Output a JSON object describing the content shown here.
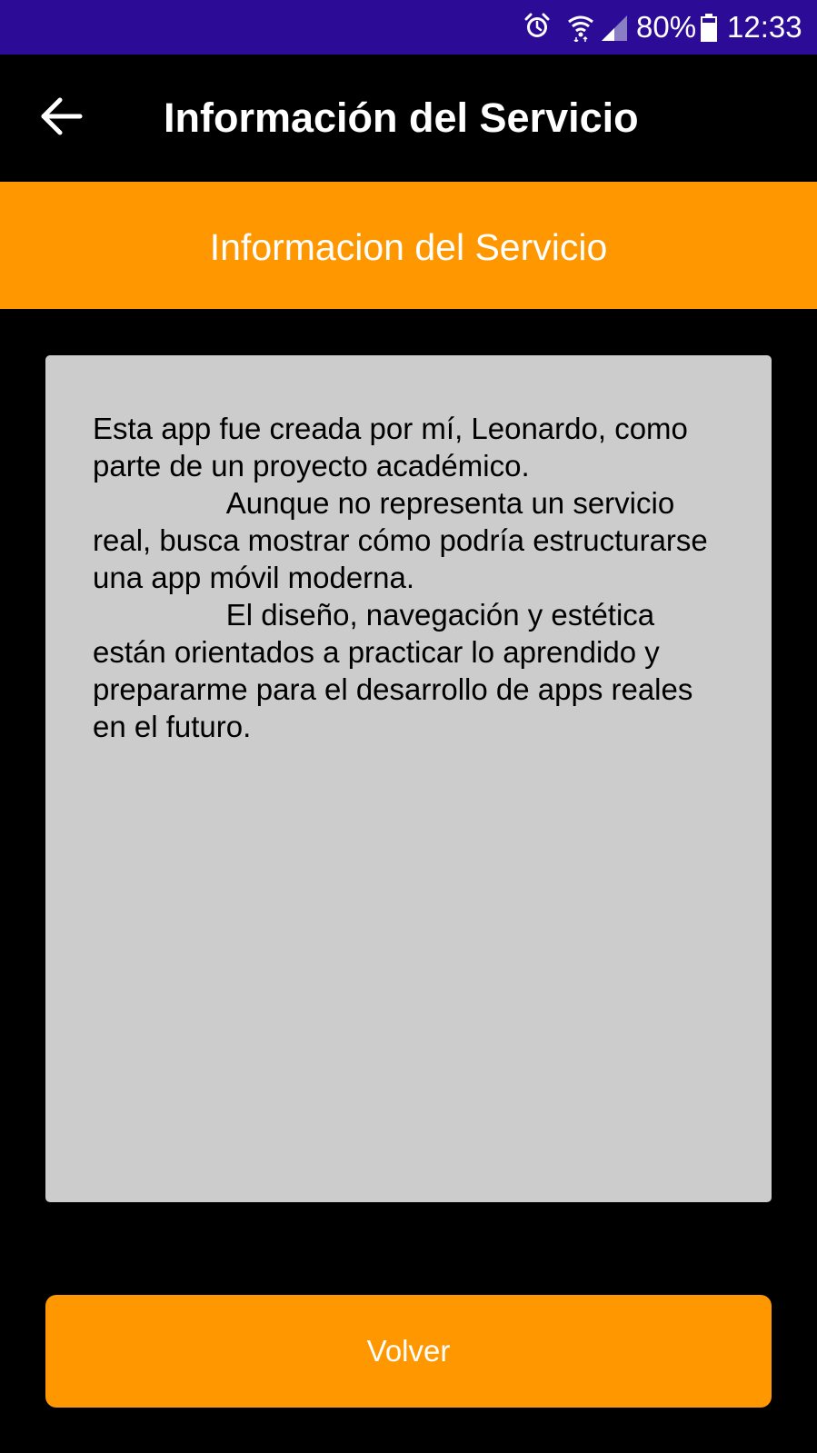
{
  "status_bar": {
    "battery_percent": "80%",
    "time": "12:33",
    "icons": [
      "alarm-icon",
      "wifi-icon",
      "signal-icon",
      "battery-icon"
    ],
    "background_color": "#2c0c96"
  },
  "app_bar": {
    "back_icon": "arrow-left-icon",
    "title": "Información del Servicio"
  },
  "banner": {
    "title": "Informacion del Servicio",
    "background_color": "#ff9800"
  },
  "info": {
    "text": "Esta app fue creada por mí, Leonardo, como parte de un proyecto académico.\n                Aunque no representa un servicio real, busca mostrar cómo podría estructurarse una app móvil moderna.\n                El diseño, navegación y estética están orientados a practicar lo aprendido y prepararme para el desarrollo de apps reales en el futuro.",
    "background_color": "#cccccc"
  },
  "volver_button": {
    "label": "Volver",
    "background_color": "#ff9800"
  }
}
